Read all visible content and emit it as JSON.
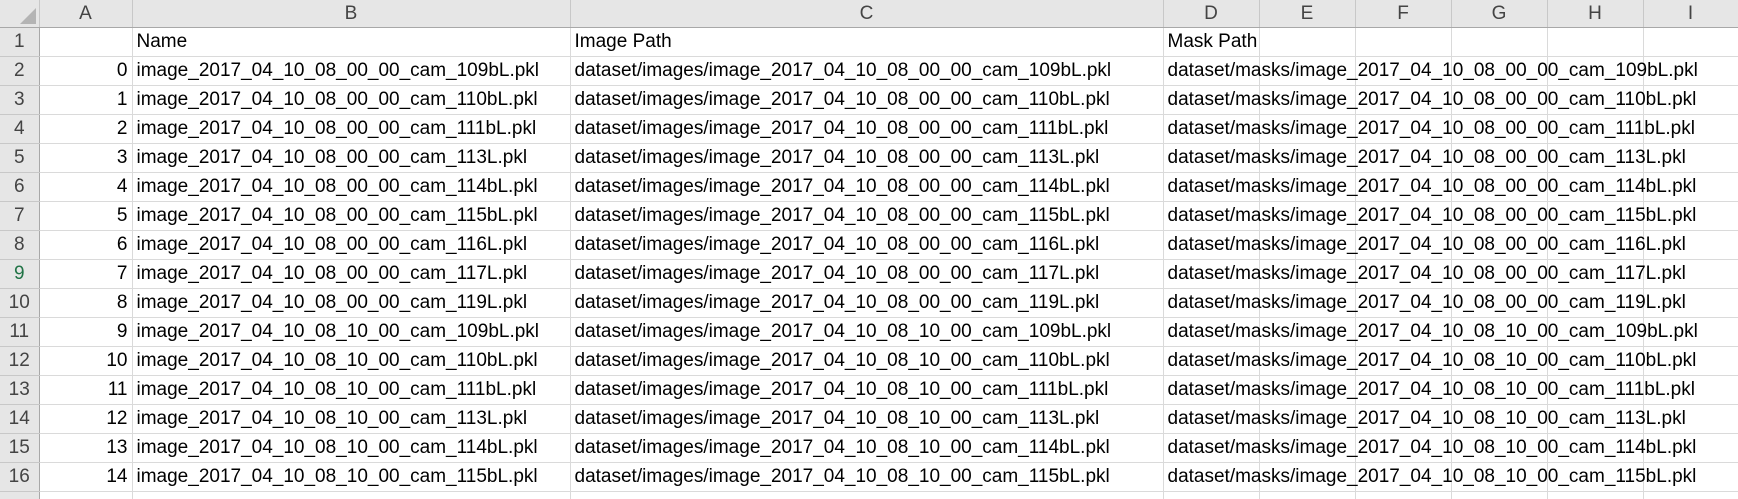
{
  "columns": [
    "A",
    "B",
    "C",
    "D",
    "E",
    "F",
    "G",
    "H",
    "I"
  ],
  "header_row": {
    "row_number": "1",
    "A": "",
    "B": "Name",
    "C": "Image Path",
    "D": "Mask Path"
  },
  "rows": [
    {
      "row_number": "2",
      "index": "0",
      "name": "image_2017_04_10_08_00_00_cam_109bL.pkl",
      "image_path": "dataset/images/image_2017_04_10_08_00_00_cam_109bL.pkl",
      "mask_path": "dataset/masks/image_2017_04_10_08_00_00_cam_109bL.pkl"
    },
    {
      "row_number": "3",
      "index": "1",
      "name": "image_2017_04_10_08_00_00_cam_110bL.pkl",
      "image_path": "dataset/images/image_2017_04_10_08_00_00_cam_110bL.pkl",
      "mask_path": "dataset/masks/image_2017_04_10_08_00_00_cam_110bL.pkl"
    },
    {
      "row_number": "4",
      "index": "2",
      "name": "image_2017_04_10_08_00_00_cam_111bL.pkl",
      "image_path": "dataset/images/image_2017_04_10_08_00_00_cam_111bL.pkl",
      "mask_path": "dataset/masks/image_2017_04_10_08_00_00_cam_111bL.pkl"
    },
    {
      "row_number": "5",
      "index": "3",
      "name": "image_2017_04_10_08_00_00_cam_113L.pkl",
      "image_path": "dataset/images/image_2017_04_10_08_00_00_cam_113L.pkl",
      "mask_path": "dataset/masks/image_2017_04_10_08_00_00_cam_113L.pkl"
    },
    {
      "row_number": "6",
      "index": "4",
      "name": "image_2017_04_10_08_00_00_cam_114bL.pkl",
      "image_path": "dataset/images/image_2017_04_10_08_00_00_cam_114bL.pkl",
      "mask_path": "dataset/masks/image_2017_04_10_08_00_00_cam_114bL.pkl"
    },
    {
      "row_number": "7",
      "index": "5",
      "name": "image_2017_04_10_08_00_00_cam_115bL.pkl",
      "image_path": "dataset/images/image_2017_04_10_08_00_00_cam_115bL.pkl",
      "mask_path": "dataset/masks/image_2017_04_10_08_00_00_cam_115bL.pkl"
    },
    {
      "row_number": "8",
      "index": "6",
      "name": "image_2017_04_10_08_00_00_cam_116L.pkl",
      "image_path": "dataset/images/image_2017_04_10_08_00_00_cam_116L.pkl",
      "mask_path": "dataset/masks/image_2017_04_10_08_00_00_cam_116L.pkl"
    },
    {
      "row_number": "9",
      "index": "7",
      "name": "image_2017_04_10_08_00_00_cam_117L.pkl",
      "image_path": "dataset/images/image_2017_04_10_08_00_00_cam_117L.pkl",
      "mask_path": "dataset/masks/image_2017_04_10_08_00_00_cam_117L.pkl"
    },
    {
      "row_number": "10",
      "index": "8",
      "name": "image_2017_04_10_08_00_00_cam_119L.pkl",
      "image_path": "dataset/images/image_2017_04_10_08_00_00_cam_119L.pkl",
      "mask_path": "dataset/masks/image_2017_04_10_08_00_00_cam_119L.pkl"
    },
    {
      "row_number": "11",
      "index": "9",
      "name": "image_2017_04_10_08_10_00_cam_109bL.pkl",
      "image_path": "dataset/images/image_2017_04_10_08_10_00_cam_109bL.pkl",
      "mask_path": "dataset/masks/image_2017_04_10_08_10_00_cam_109bL.pkl"
    },
    {
      "row_number": "12",
      "index": "10",
      "name": "image_2017_04_10_08_10_00_cam_110bL.pkl",
      "image_path": "dataset/images/image_2017_04_10_08_10_00_cam_110bL.pkl",
      "mask_path": "dataset/masks/image_2017_04_10_08_10_00_cam_110bL.pkl"
    },
    {
      "row_number": "13",
      "index": "11",
      "name": "image_2017_04_10_08_10_00_cam_111bL.pkl",
      "image_path": "dataset/images/image_2017_04_10_08_10_00_cam_111bL.pkl",
      "mask_path": "dataset/masks/image_2017_04_10_08_10_00_cam_111bL.pkl"
    },
    {
      "row_number": "14",
      "index": "12",
      "name": "image_2017_04_10_08_10_00_cam_113L.pkl",
      "image_path": "dataset/images/image_2017_04_10_08_10_00_cam_113L.pkl",
      "mask_path": "dataset/masks/image_2017_04_10_08_10_00_cam_113L.pkl"
    },
    {
      "row_number": "15",
      "index": "13",
      "name": "image_2017_04_10_08_10_00_cam_114bL.pkl",
      "image_path": "dataset/images/image_2017_04_10_08_10_00_cam_114bL.pkl",
      "mask_path": "dataset/masks/image_2017_04_10_08_10_00_cam_114bL.pkl"
    },
    {
      "row_number": "16",
      "index": "14",
      "name": "image_2017_04_10_08_10_00_cam_115bL.pkl",
      "image_path": "dataset/images/image_2017_04_10_08_10_00_cam_115bL.pkl",
      "mask_path": "dataset/masks/image_2017_04_10_08_10_00_cam_115bL.pkl"
    }
  ],
  "selected_row_number": "9",
  "colors": {
    "header_bg": "#e6e6e6",
    "header_text": "#444444",
    "gridline": "#dadada",
    "selected_row_header_text": "#217346"
  }
}
